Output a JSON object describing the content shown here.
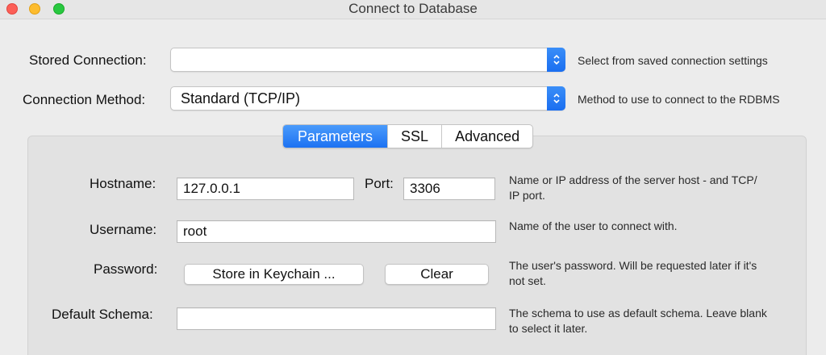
{
  "window": {
    "title": "Connect to Database"
  },
  "stored_connection": {
    "label": "Stored Connection:",
    "value": "",
    "hint": "Select from saved connection settings"
  },
  "connection_method": {
    "label": "Connection Method:",
    "value": "Standard (TCP/IP)",
    "hint": "Method to use to connect to the RDBMS"
  },
  "tabs": [
    {
      "label": "Parameters",
      "active": true
    },
    {
      "label": "SSL",
      "active": false
    },
    {
      "label": "Advanced",
      "active": false
    }
  ],
  "parameters": {
    "hostname": {
      "label": "Hostname:",
      "value": "127.0.0.1",
      "desc_line1": "Name or IP address of the server host - and TCP/",
      "desc_line2": "IP port."
    },
    "port": {
      "label": "Port:",
      "value": "3306"
    },
    "username": {
      "label": "Username:",
      "value": "root",
      "desc_line1": "Name of the user to connect with."
    },
    "password": {
      "label": "Password:",
      "store_button": "Store in Keychain ...",
      "clear_button": "Clear",
      "desc_line1": "The user's password. Will be requested later if it's",
      "desc_line2": "not set."
    },
    "default_schema": {
      "label": "Default Schema:",
      "value": "",
      "desc_line1": "The schema to use as default schema. Leave blank",
      "desc_line2": "to select it later."
    }
  },
  "colors": {
    "accent": "#1d72f2",
    "close": "#fc5f57",
    "minimize": "#fdbc2e",
    "maximize": "#28c840"
  }
}
